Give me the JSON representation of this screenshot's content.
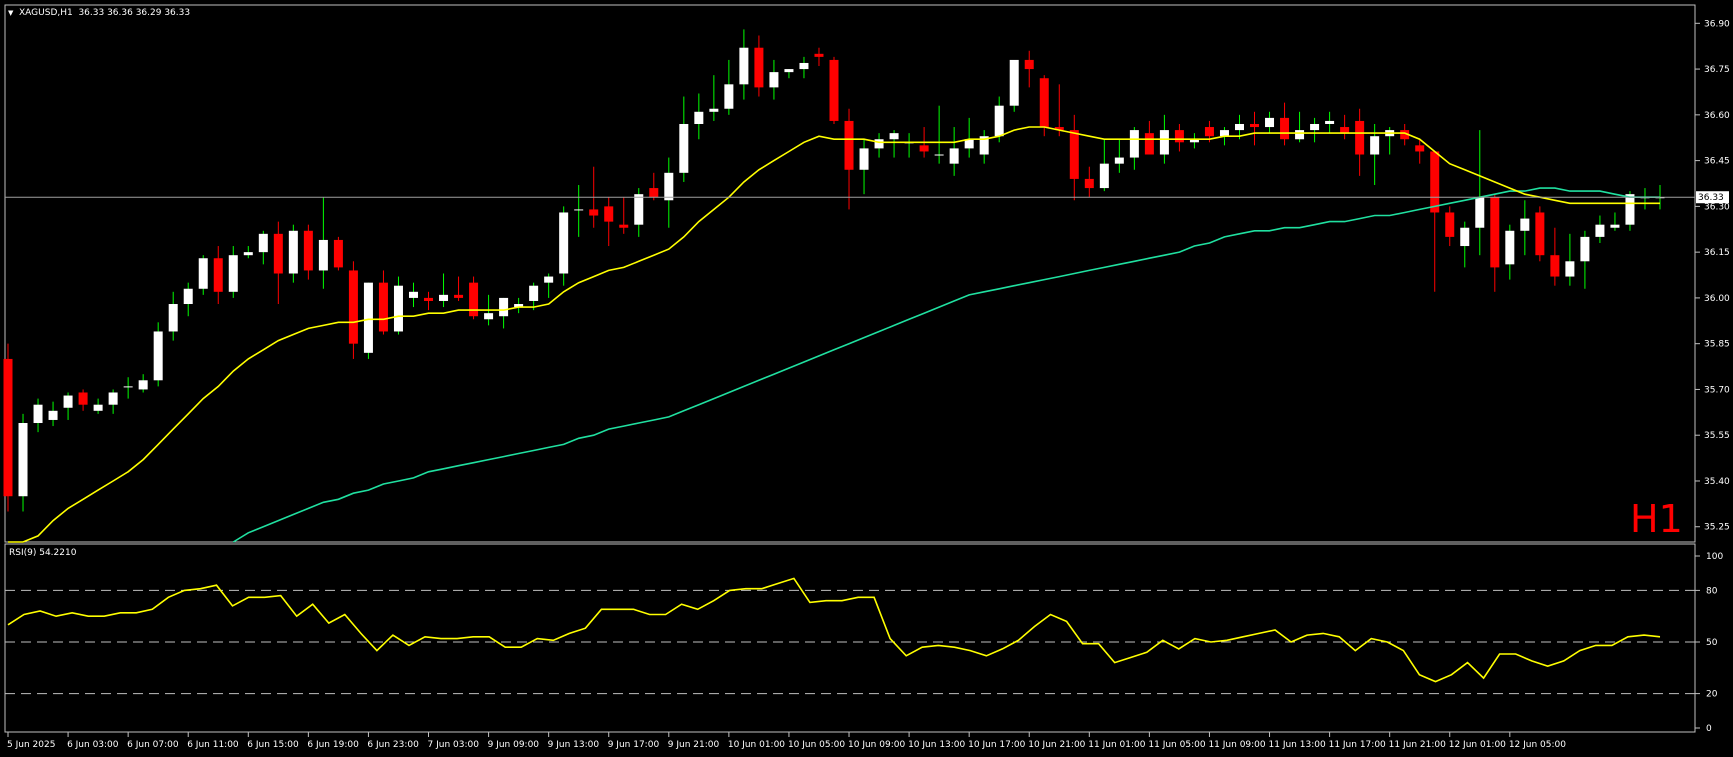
{
  "colors": {
    "background": "#000000",
    "frame": "#c0c0c0",
    "bull_body": "#ffffff",
    "bear_body": "#ff0000",
    "bull_wick": "#00ff00",
    "bear_wick": "#ff0000",
    "ma_fast": "#ffff00",
    "ma_slow": "#20e0a0",
    "rsi_line": "#ffff00",
    "current_price_line": "#a0a0a0",
    "timeframe_label": "#ff0000"
  },
  "header": {
    "symbol_line": "XAGUSD,H1  36.33 36.36 36.29 36.33",
    "menu_icon": "triangle-down-icon"
  },
  "timeframe_label": "H1",
  "current_price_label": "36.33",
  "rsi_header": "RSI(9) 54.2210",
  "chart_data": [
    {
      "type": "candlestick",
      "ylim": [
        35.2,
        36.96
      ],
      "y_ticks": [
        "36.90",
        "36.75",
        "36.60",
        "36.45",
        "36.30",
        "36.15",
        "36.00",
        "35.85",
        "35.70",
        "35.55",
        "35.40",
        "35.25"
      ],
      "current_price": 36.33,
      "x_tick_labels": [
        {
          "index": 0,
          "label": "5 Jun 2025"
        },
        {
          "index": 4,
          "label": "6 Jun 03:00"
        },
        {
          "index": 8,
          "label": "6 Jun 07:00"
        },
        {
          "index": 12,
          "label": "6 Jun 11:00"
        },
        {
          "index": 16,
          "label": "6 Jun 15:00"
        },
        {
          "index": 20,
          "label": "6 Jun 19:00"
        },
        {
          "index": 24,
          "label": "6 Jun 23:00"
        },
        {
          "index": 28,
          "label": "7 Jun 03:00"
        },
        {
          "index": 32,
          "label": "9 Jun 09:00"
        },
        {
          "index": 36,
          "label": "9 Jun 13:00"
        },
        {
          "index": 40,
          "label": "9 Jun 17:00"
        },
        {
          "index": 44,
          "label": "9 Jun 21:00"
        },
        {
          "index": 48,
          "label": "10 Jun 01:00"
        },
        {
          "index": 52,
          "label": "10 Jun 05:00"
        },
        {
          "index": 56,
          "label": "10 Jun 09:00"
        },
        {
          "index": 60,
          "label": "10 Jun 13:00"
        },
        {
          "index": 64,
          "label": "10 Jun 17:00"
        },
        {
          "index": 68,
          "label": "10 Jun 21:00"
        },
        {
          "index": 72,
          "label": "11 Jun 01:00"
        },
        {
          "index": 76,
          "label": "11 Jun 05:00"
        },
        {
          "index": 80,
          "label": "11 Jun 09:00"
        },
        {
          "index": 84,
          "label": "11 Jun 13:00"
        },
        {
          "index": 88,
          "label": "11 Jun 17:00"
        },
        {
          "index": 92,
          "label": "11 Jun 21:00"
        },
        {
          "index": 96,
          "label": "12 Jun 01:00"
        },
        {
          "index": 100,
          "label": "12 Jun 05:00"
        }
      ],
      "ohlc": [
        [
          35.8,
          35.85,
          35.3,
          35.35
        ],
        [
          35.35,
          35.62,
          35.3,
          35.59
        ],
        [
          35.59,
          35.67,
          35.56,
          35.65
        ],
        [
          35.6,
          35.66,
          35.58,
          35.63
        ],
        [
          35.64,
          35.69,
          35.6,
          35.68
        ],
        [
          35.69,
          35.7,
          35.63,
          35.65
        ],
        [
          35.63,
          35.67,
          35.62,
          35.65
        ],
        [
          35.65,
          35.7,
          35.62,
          35.69
        ],
        [
          35.71,
          35.74,
          35.67,
          35.71
        ],
        [
          35.7,
          35.75,
          35.69,
          35.73
        ],
        [
          35.73,
          35.92,
          35.71,
          35.89
        ],
        [
          35.89,
          36.02,
          35.86,
          35.98
        ],
        [
          35.98,
          36.05,
          35.94,
          36.03
        ],
        [
          36.03,
          36.14,
          36.01,
          36.13
        ],
        [
          36.13,
          36.17,
          35.98,
          36.02
        ],
        [
          36.02,
          36.17,
          36.0,
          36.14
        ],
        [
          36.14,
          36.17,
          36.13,
          36.15
        ],
        [
          36.15,
          36.22,
          36.11,
          36.21
        ],
        [
          36.21,
          36.25,
          35.98,
          36.08
        ],
        [
          36.08,
          36.24,
          36.05,
          36.22
        ],
        [
          36.22,
          36.24,
          36.06,
          36.09
        ],
        [
          36.09,
          36.33,
          36.03,
          36.19
        ],
        [
          36.19,
          36.2,
          36.09,
          36.1
        ],
        [
          36.09,
          36.12,
          35.8,
          35.85
        ],
        [
          35.82,
          36.05,
          35.8,
          36.05
        ],
        [
          36.05,
          36.09,
          35.88,
          35.89
        ],
        [
          35.89,
          36.07,
          35.88,
          36.04
        ],
        [
          36.0,
          36.05,
          35.97,
          36.02
        ],
        [
          36.0,
          36.02,
          35.96,
          35.99
        ],
        [
          35.99,
          36.08,
          35.97,
          36.01
        ],
        [
          36.01,
          36.07,
          35.99,
          36.0
        ],
        [
          36.05,
          36.07,
          35.93,
          35.94
        ],
        [
          35.93,
          36.01,
          35.91,
          35.95
        ],
        [
          35.94,
          36.0,
          35.9,
          36.0
        ],
        [
          35.97,
          36.0,
          35.95,
          35.98
        ],
        [
          35.99,
          36.05,
          35.96,
          36.04
        ],
        [
          36.05,
          36.08,
          36.0,
          36.07
        ],
        [
          36.08,
          36.3,
          36.04,
          36.28
        ],
        [
          36.29,
          36.37,
          36.2,
          36.29
        ],
        [
          36.29,
          36.43,
          36.23,
          36.27
        ],
        [
          36.3,
          36.33,
          36.17,
          36.25
        ],
        [
          36.24,
          36.33,
          36.21,
          36.23
        ],
        [
          36.24,
          36.36,
          36.2,
          36.34
        ],
        [
          36.36,
          36.41,
          36.32,
          36.33
        ],
        [
          36.32,
          36.46,
          36.23,
          36.41
        ],
        [
          36.41,
          36.66,
          36.38,
          36.57
        ],
        [
          36.57,
          36.67,
          36.52,
          36.61
        ],
        [
          36.61,
          36.73,
          36.58,
          36.62
        ],
        [
          36.62,
          36.78,
          36.6,
          36.7
        ],
        [
          36.7,
          36.88,
          36.65,
          36.82
        ],
        [
          36.82,
          36.86,
          36.66,
          36.69
        ],
        [
          36.69,
          36.78,
          36.65,
          36.74
        ],
        [
          36.74,
          36.75,
          36.72,
          36.75
        ],
        [
          36.75,
          36.79,
          36.72,
          36.77
        ],
        [
          36.8,
          36.82,
          36.76,
          36.79
        ],
        [
          36.78,
          36.79,
          36.57,
          36.58
        ],
        [
          36.58,
          36.62,
          36.29,
          36.42
        ],
        [
          36.42,
          36.52,
          36.34,
          36.49
        ],
        [
          36.49,
          36.54,
          36.46,
          36.52
        ],
        [
          36.52,
          36.55,
          36.46,
          36.54
        ],
        [
          36.51,
          36.54,
          36.46,
          36.51
        ],
        [
          36.5,
          36.56,
          36.46,
          36.48
        ],
        [
          36.47,
          36.63,
          36.44,
          36.47
        ],
        [
          36.44,
          36.56,
          36.4,
          36.49
        ],
        [
          36.49,
          36.59,
          36.46,
          36.52
        ],
        [
          36.47,
          36.55,
          36.44,
          36.53
        ],
        [
          36.53,
          36.66,
          36.51,
          36.63
        ],
        [
          36.63,
          36.75,
          36.61,
          36.78
        ],
        [
          36.78,
          36.81,
          36.69,
          36.75
        ],
        [
          36.72,
          36.73,
          36.53,
          36.56
        ],
        [
          36.56,
          36.7,
          36.53,
          36.55
        ],
        [
          36.55,
          36.6,
          36.32,
          36.39
        ],
        [
          36.39,
          36.43,
          36.33,
          36.36
        ],
        [
          36.36,
          36.52,
          36.35,
          36.44
        ],
        [
          36.44,
          36.52,
          36.41,
          36.46
        ],
        [
          36.46,
          36.56,
          36.42,
          36.55
        ],
        [
          36.54,
          36.58,
          36.47,
          36.47
        ],
        [
          36.47,
          36.6,
          36.44,
          36.55
        ],
        [
          36.55,
          36.57,
          36.48,
          36.51
        ],
        [
          36.51,
          36.54,
          36.49,
          36.52
        ],
        [
          36.56,
          36.58,
          36.51,
          36.53
        ],
        [
          36.53,
          36.56,
          36.5,
          36.55
        ],
        [
          36.55,
          36.6,
          36.52,
          36.57
        ],
        [
          36.57,
          36.61,
          36.5,
          36.56
        ],
        [
          36.56,
          36.61,
          36.54,
          36.59
        ],
        [
          36.59,
          36.64,
          36.5,
          36.52
        ],
        [
          36.52,
          36.61,
          36.51,
          36.55
        ],
        [
          36.55,
          36.59,
          36.51,
          36.57
        ],
        [
          36.57,
          36.61,
          36.54,
          36.58
        ],
        [
          36.56,
          36.6,
          36.52,
          36.54
        ],
        [
          36.58,
          36.62,
          36.4,
          36.47
        ],
        [
          36.47,
          36.57,
          36.37,
          36.53
        ],
        [
          36.53,
          36.56,
          36.47,
          36.55
        ],
        [
          36.55,
          36.57,
          36.5,
          36.52
        ],
        [
          36.5,
          36.52,
          36.44,
          36.48
        ],
        [
          36.48,
          36.48,
          36.02,
          36.28
        ],
        [
          36.28,
          36.3,
          36.17,
          36.2
        ],
        [
          36.17,
          36.25,
          36.1,
          36.23
        ],
        [
          36.23,
          36.55,
          36.14,
          36.33
        ],
        [
          36.33,
          36.34,
          36.02,
          36.1
        ],
        [
          36.11,
          36.24,
          36.06,
          36.22
        ],
        [
          36.22,
          36.32,
          36.14,
          36.26
        ],
        [
          36.28,
          36.3,
          36.12,
          36.14
        ],
        [
          36.14,
          36.23,
          36.04,
          36.07
        ],
        [
          36.07,
          36.21,
          36.04,
          36.12
        ],
        [
          36.12,
          36.22,
          36.03,
          36.2
        ],
        [
          36.2,
          36.27,
          36.18,
          36.24
        ],
        [
          36.23,
          36.28,
          36.22,
          36.24
        ],
        [
          36.24,
          36.35,
          36.22,
          36.34
        ],
        [
          36.33,
          36.36,
          36.29,
          36.33
        ],
        [
          36.33,
          36.37,
          36.29,
          36.33
        ]
      ],
      "series": [
        {
          "values": [
            35.12,
            35.18,
            35.22,
            35.27,
            35.31,
            35.34,
            35.37,
            35.4,
            35.43,
            35.47,
            35.52,
            35.57,
            35.62,
            35.67,
            35.71,
            35.76,
            35.8,
            35.83,
            35.86,
            35.88,
            35.9,
            35.91,
            35.92,
            35.92,
            35.93,
            35.93,
            35.94,
            35.94,
            35.95,
            35.95,
            35.96,
            35.96,
            35.96,
            35.96,
            35.97,
            35.97,
            35.98,
            36.02,
            36.05,
            36.07,
            36.09,
            36.1,
            36.12,
            36.14,
            36.16,
            36.2,
            36.25,
            36.29,
            36.33,
            36.38,
            36.42,
            36.45,
            36.48,
            36.51,
            36.53,
            36.52,
            36.52,
            36.52,
            36.51,
            36.51,
            36.51,
            36.51,
            36.51,
            36.51,
            36.52,
            36.52,
            36.53,
            36.55,
            36.56,
            36.56,
            36.55,
            36.54,
            36.53,
            36.52,
            36.52,
            36.52,
            36.52,
            36.52,
            36.52,
            36.52,
            36.52,
            36.53,
            36.53,
            36.54,
            36.54,
            36.54,
            36.54,
            36.54,
            36.54,
            36.54,
            36.54,
            36.54,
            36.54,
            36.54,
            36.52,
            36.48,
            36.44,
            36.42,
            36.4,
            36.38,
            36.36,
            36.34,
            36.33,
            36.32,
            36.31,
            36.31,
            36.31,
            36.31,
            36.31,
            36.31,
            36.31
          ]
        },
        {
          "values": [
            34.3,
            34.38,
            34.46,
            34.54,
            34.62,
            34.7,
            34.76,
            34.82,
            34.88,
            34.94,
            35.0,
            35.05,
            35.1,
            35.14,
            35.17,
            35.2,
            35.23,
            35.25,
            35.27,
            35.29,
            35.31,
            35.33,
            35.34,
            35.36,
            35.37,
            35.39,
            35.4,
            35.41,
            35.43,
            35.44,
            35.45,
            35.46,
            35.47,
            35.48,
            35.49,
            35.5,
            35.51,
            35.52,
            35.54,
            35.55,
            35.57,
            35.58,
            35.59,
            35.6,
            35.61,
            35.63,
            35.65,
            35.67,
            35.69,
            35.71,
            35.73,
            35.75,
            35.77,
            35.79,
            35.81,
            35.83,
            35.85,
            35.87,
            35.89,
            35.91,
            35.93,
            35.95,
            35.97,
            35.99,
            36.01,
            36.02,
            36.03,
            36.04,
            36.05,
            36.06,
            36.07,
            36.08,
            36.09,
            36.1,
            36.11,
            36.12,
            36.13,
            36.14,
            36.15,
            36.17,
            36.18,
            36.2,
            36.21,
            36.22,
            36.22,
            36.23,
            36.23,
            36.24,
            36.25,
            36.25,
            36.26,
            36.27,
            36.27,
            36.28,
            36.29,
            36.3,
            36.31,
            36.32,
            36.33,
            36.34,
            36.35,
            36.35,
            36.36,
            36.36,
            36.35,
            36.35,
            36.35,
            36.34,
            36.33,
            36.33,
            36.33
          ]
        }
      ]
    },
    {
      "type": "line",
      "ylim": [
        0,
        100
      ],
      "y_ticks": [
        "100",
        "80",
        "50",
        "20",
        "0"
      ],
      "levels": [
        80,
        50,
        20
      ],
      "values": [
        60,
        66,
        68,
        65,
        67,
        65,
        65,
        67,
        67,
        69,
        76,
        80,
        81,
        83,
        71,
        76,
        76,
        77,
        65,
        72,
        61,
        66,
        55,
        45,
        54,
        48,
        53,
        52,
        52,
        53,
        53,
        47,
        47,
        52,
        51,
        55,
        58,
        69,
        69,
        69,
        66,
        66,
        72,
        69,
        74,
        80,
        81,
        81,
        84,
        87,
        73,
        74,
        74,
        76,
        76,
        52,
        42,
        47,
        48,
        47,
        45,
        42,
        46,
        51,
        59,
        66,
        62,
        49,
        49,
        38,
        41,
        44,
        51,
        46,
        52,
        50,
        51,
        53,
        55,
        57,
        50,
        54,
        55,
        53,
        45,
        52,
        50,
        45,
        31,
        27,
        31,
        38,
        29,
        43,
        43,
        39,
        36,
        39,
        45,
        48,
        48,
        53,
        54,
        53
      ]
    }
  ]
}
